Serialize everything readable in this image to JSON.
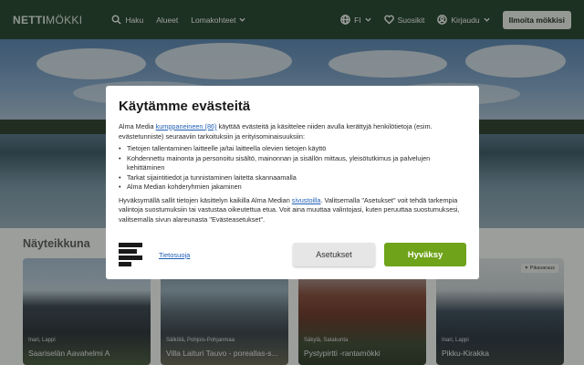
{
  "header": {
    "logo_bold": "NETTI",
    "logo_rest": "MÖKKI",
    "nav": [
      {
        "label": "Haku",
        "icon": "search-icon"
      },
      {
        "label": "Alueet"
      },
      {
        "label": "Lomakohteet",
        "icon": "chevron-down-icon"
      }
    ],
    "language": "FI",
    "favorites": "Suosikit",
    "login": "Kirjaudu",
    "cta": "Ilmoita mökkisi"
  },
  "section": {
    "title": "Näyteikkuna"
  },
  "cards": [
    {
      "location": "Inari, Lappi",
      "name": "Saariselän Aavahelmi A",
      "badge": ""
    },
    {
      "location": "Sälkölä, Pohjois-Pohjanmaa",
      "name": "Villa Laituri Tauvo - poreallas-s...",
      "badge": ""
    },
    {
      "location": "Säkylä, Satakunta",
      "name": "Pystypirtti -rantamökki",
      "badge": ""
    },
    {
      "location": "Inari, Lappi",
      "name": "Pikku-Kirakka",
      "badge": "Pikavaraus"
    }
  ],
  "modal": {
    "title": "Käytämme evästeitä",
    "intro_before": "Alma Media ",
    "intro_link": "kumppaneineen (86)",
    "intro_after": " käyttää evästeitä ja käsittelee niiden avulla kerättyjä henkilötietoja (esim. evästetunniste) seuraaviin tarkoituksiin ja erityisominaisuuksiin:",
    "bullets": [
      "Tietojen tallentaminen laitteelle ja/tai laitteella olevien tietojen käyttö",
      "Kohdennettu mainonta ja personoitu sisältö, mainonnan ja sisällön mittaus, yleisötutkimus ja palvelujen kehittäminen",
      "Tarkat sijaintitiedot ja tunnistaminen laitetta skannaamalla",
      "Alma Median kohderyhmien jakaminen"
    ],
    "outro_before": "Hyväksymällä sallit tietojen käsittelyn kaikilla Alma Median ",
    "outro_link": "sivustoilla",
    "outro_after": ". Valitsemalla \"Asetukset\" voit tehdä tarkempia valintoja suostumuksiin tai vastustaa oikeutettua etua. Voit aina muuttaa valintojasi, kuten peruuttaa suostumuksesi, valitsemalla sivun alareunasta \"Evästeasetukset\".",
    "privacy_link": "Tietosuoja",
    "settings_button": "Asetukset",
    "accept_button": "Hyväksy",
    "accept_color": "#6fa31a"
  }
}
